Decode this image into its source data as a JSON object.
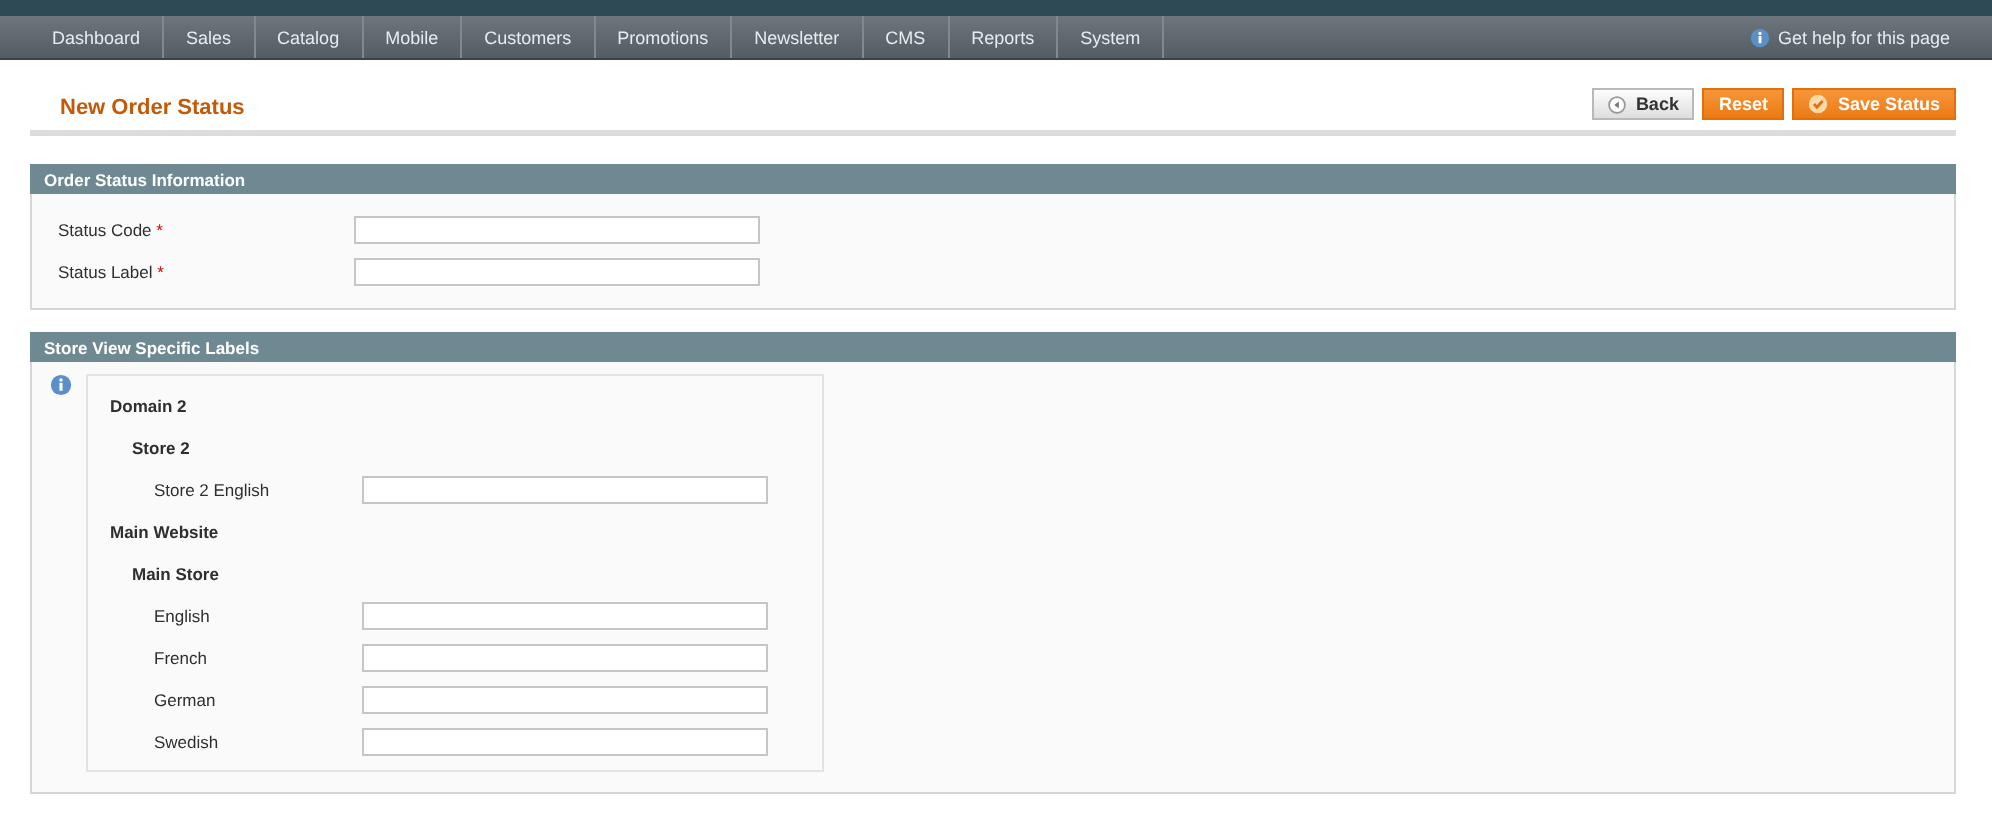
{
  "nav": {
    "items": [
      {
        "label": "Dashboard",
        "selected": false
      },
      {
        "label": "Sales",
        "selected": false
      },
      {
        "label": "Catalog",
        "selected": false
      },
      {
        "label": "Mobile",
        "selected": false
      },
      {
        "label": "Customers",
        "selected": false
      },
      {
        "label": "Promotions",
        "selected": false
      },
      {
        "label": "Newsletter",
        "selected": false
      },
      {
        "label": "CMS",
        "selected": false
      },
      {
        "label": "Reports",
        "selected": false
      },
      {
        "label": "System",
        "selected": false
      }
    ],
    "help": "Get help for this page"
  },
  "page": {
    "title": "New Order Status",
    "buttons": [
      {
        "label": "Back",
        "kind": "back"
      },
      {
        "label": "Reset",
        "kind": "reset"
      },
      {
        "label": "Save Status",
        "kind": "save"
      }
    ]
  },
  "sections": [
    {
      "title": "Order Status Information",
      "fields": [
        {
          "label": "Status Code",
          "required_mark": "*"
        },
        {
          "label": "Status Label",
          "required_mark": "*"
        }
      ]
    },
    {
      "title": "Store View Specific Labels",
      "tree": [
        {
          "label": "Domain 2",
          "children": [
            {
              "label": "Store 2",
              "children": [
                {
                  "label": "Store 2 English"
                }
              ]
            }
          ]
        },
        {
          "label": "Main Website",
          "children": [
            {
              "label": "Main Store",
              "children": [
                {
                  "label": "English"
                },
                {
                  "label": "French"
                },
                {
                  "label": "German"
                },
                {
                  "label": "Swedish"
                }
              ]
            }
          ]
        }
      ]
    }
  ]
}
